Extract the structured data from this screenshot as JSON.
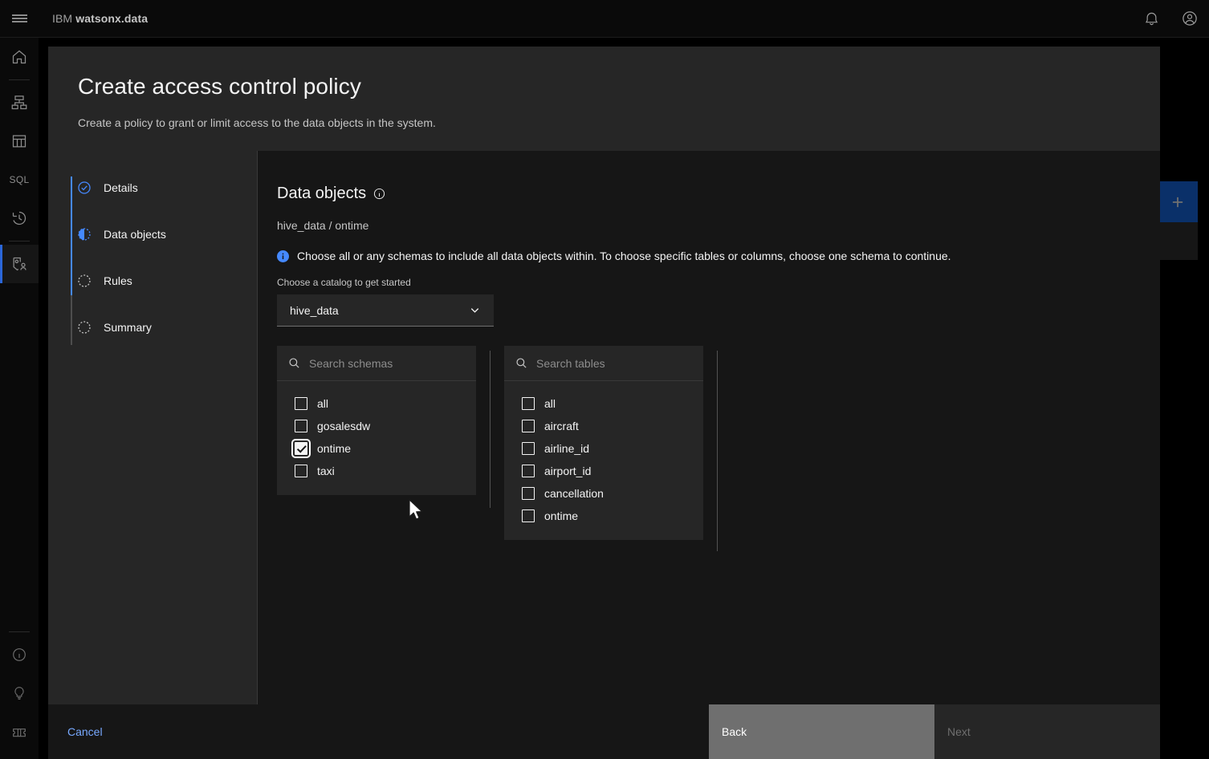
{
  "header": {
    "menu_icon": "hamburger-icon",
    "brand_prefix": "IBM",
    "brand_name": "watsonx.data",
    "notifications_icon": "bell-icon",
    "account_icon": "user-avatar-icon"
  },
  "left_rail": {
    "items": [
      {
        "name": "home",
        "icon": "home-icon",
        "active": false
      },
      {
        "name": "infrastructure",
        "icon": "infrastructure-icon",
        "active": false
      },
      {
        "name": "data-manager",
        "icon": "data-table-icon",
        "active": false
      },
      {
        "name": "sql",
        "icon": "sql-text-icon",
        "label": "SQL",
        "active": false
      },
      {
        "name": "query-history",
        "icon": "history-icon",
        "active": false
      },
      {
        "name": "access-control",
        "icon": "access-control-icon",
        "active": true
      }
    ],
    "bottom_items": [
      {
        "name": "about",
        "icon": "information-icon"
      },
      {
        "name": "tips",
        "icon": "lightbulb-icon"
      },
      {
        "name": "support",
        "icon": "ticket-icon"
      }
    ]
  },
  "background": {
    "add_button_label": "+",
    "accent_blue": "#0a3069"
  },
  "modal": {
    "title": "Create access control policy",
    "subtitle": "Create a policy to grant or limit access to the data objects in the system."
  },
  "progress": {
    "steps": [
      {
        "label": "Details",
        "state": "complete",
        "icon": "checkmark-circle-icon"
      },
      {
        "label": "Data objects",
        "state": "current",
        "icon": "incomplete-circle-icon"
      },
      {
        "label": "Rules",
        "state": "incomplete",
        "icon": "dashed-circle-icon"
      },
      {
        "label": "Summary",
        "state": "incomplete",
        "icon": "dashed-circle-icon"
      }
    ]
  },
  "content": {
    "section_title": "Data objects",
    "section_title_info_icon": "information-icon",
    "breadcrumb": "hive_data / ontime",
    "info_icon": "information-filled-icon",
    "info_text": "Choose all or any schemas to include all data objects within. To choose specific tables or columns, choose one schema to continue.",
    "catalog_label": "Choose a catalog to get started",
    "catalog_value": "hive_data",
    "catalog_chevron_icon": "chevron-down-icon",
    "schemas_panel": {
      "search_placeholder": "Search schemas",
      "search_value": "",
      "search_icon": "search-icon",
      "items": [
        {
          "label": "all",
          "checked": false
        },
        {
          "label": "gosalesdw",
          "checked": false
        },
        {
          "label": "ontime",
          "checked": true,
          "focused": true
        },
        {
          "label": "taxi",
          "checked": false
        }
      ]
    },
    "tables_panel": {
      "search_placeholder": "Search tables",
      "search_value": "",
      "search_icon": "search-icon",
      "items": [
        {
          "label": "all",
          "checked": false
        },
        {
          "label": "aircraft",
          "checked": false
        },
        {
          "label": "airline_id",
          "checked": false
        },
        {
          "label": "airport_id",
          "checked": false
        },
        {
          "label": "cancellation",
          "checked": false
        },
        {
          "label": "ontime",
          "checked": false
        }
      ]
    }
  },
  "footer": {
    "cancel_label": "Cancel",
    "back_label": "Back",
    "next_label": "Next",
    "next_disabled": true
  },
  "colors": {
    "accent": "#4589ff",
    "link": "#78a9ff",
    "surface": "#262626",
    "background": "#161616"
  }
}
